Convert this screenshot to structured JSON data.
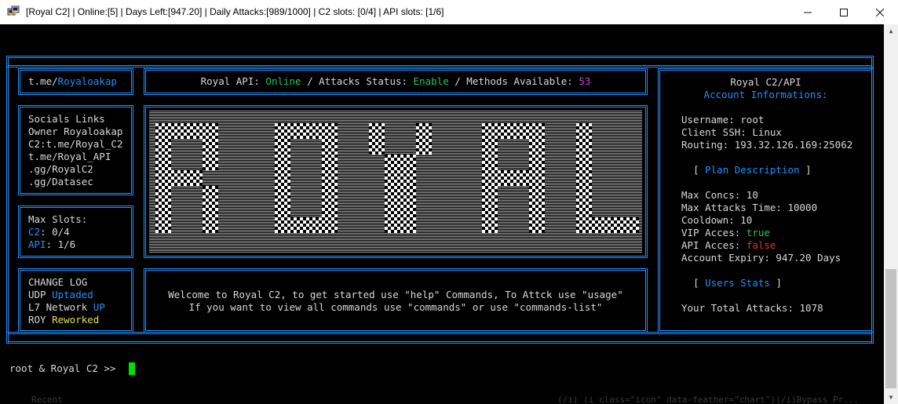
{
  "window": {
    "title": "[Royal C2] | Online:[5] | Days Left:[947.20] | Daily Attacks:[989/1000] | C2 slots: [0/4] | API slots: [1/6]",
    "app_icon": "putty-terminal-icon",
    "minimize_icon": "minimize-icon",
    "maximize_icon": "maximize-icon",
    "close_icon": "close-icon"
  },
  "colors": {
    "frame": "#1e90ff",
    "online_green": "#21c55d",
    "count_purple": "#d63fd6",
    "updated_yellow": "#e3e34b",
    "false_red": "#e03030",
    "cursor_green": "#00e000"
  },
  "header": {
    "telegram_prefix": "t.me/",
    "telegram_handle": "Royaloakap",
    "api_label": "Royal API: ",
    "api_status": "Online",
    "attacks_label": " / Attacks Status: ",
    "attacks_status": "Enable",
    "methods_label": " / Methods Available: ",
    "methods_count": "53"
  },
  "socials": {
    "lines": [
      "Socials Links",
      "Owner Royaloakap",
      "C2:t.me/Royal_C2",
      "t.me/Royal_API",
      ".gg/RoyalC2",
      ".gg/Datasec"
    ]
  },
  "logo": {
    "text": "ROYAL"
  },
  "slots": {
    "title": "Max Slots:",
    "c2_label": "C2",
    "c2_value": ": 0/4",
    "api_label": "API",
    "api_value": ": 1/6"
  },
  "changelog": {
    "title": "CHANGE LOG",
    "items": [
      {
        "name": "UDP ",
        "status": "Uptaded"
      },
      {
        "name": "L7 Network ",
        "status": "UP"
      },
      {
        "name": "ROY ",
        "status": "Reworked"
      }
    ]
  },
  "welcome": {
    "line1": "Welcome to Royal C2, to get started use \"help\" Commands, To Attck use \"usage\"",
    "line2": "If you want to view all commands use \"commands\" or use \"commands-list\""
  },
  "account": {
    "title": "Royal C2/API",
    "subtitle": "Account Informations:",
    "username_label": "Username: ",
    "username": "root",
    "client_label": "Client SSH: ",
    "client": "Linux",
    "routing_label": "Routing: ",
    "routing": "193.32.126.169:25062",
    "plan_open": "[ ",
    "plan_title": "Plan Description",
    "plan_close": " ]",
    "max_concs_label": "Max Concs: ",
    "max_concs": "10",
    "max_time_label": "Max Attacks Time: ",
    "max_time": "10000",
    "cooldown_label": "Cooldown: ",
    "cooldown": "10",
    "vip_label": "VIP Acces: ",
    "vip": "true",
    "api_label": "API Acces: ",
    "api": "false",
    "expiry_label": "Account Expiry: ",
    "expiry": "947.20 Days",
    "stats_open": "[ ",
    "stats_title": "Users Stats",
    "stats_close": " ]",
    "total_label": "Your Total Attacks: ",
    "total": "1078"
  },
  "prompt": {
    "text": "root & Royal C2 >> "
  },
  "background_bleed": {
    "left": "Recent",
    "right": "(/i) (i class=\"icon\" data-feather=\"chart\")(/i)Bypass Pr..."
  }
}
